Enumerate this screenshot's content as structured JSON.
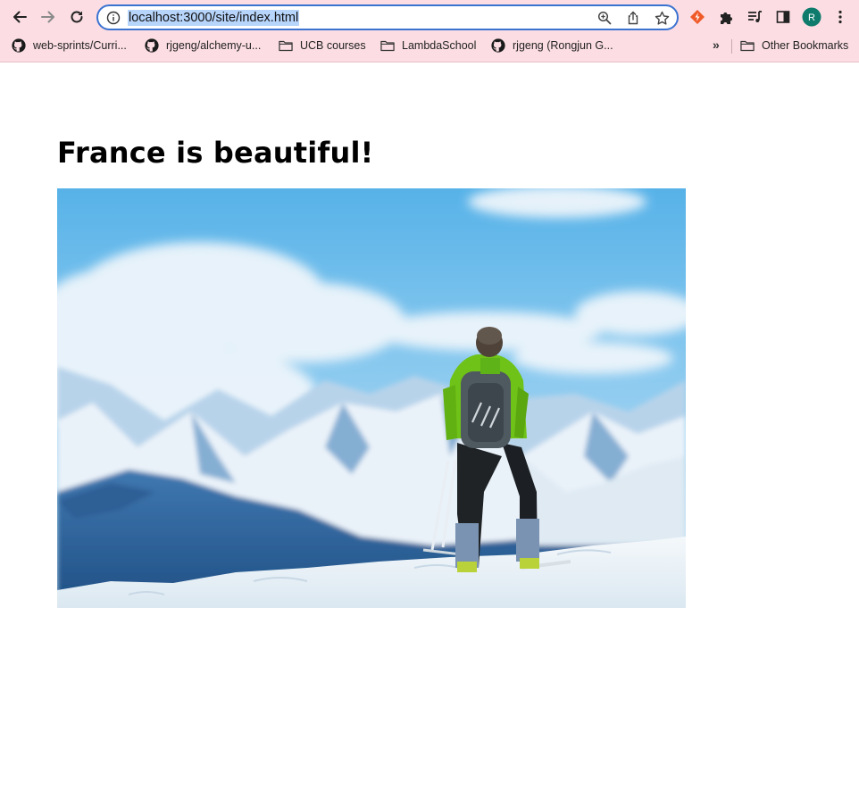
{
  "browser": {
    "url": "localhost:3000/site/index.html",
    "profile_initial": "R",
    "colors": {
      "chrome_bg": "#fbdde3",
      "omnibox_border": "#3b73d1",
      "url_selection": "#b7d4fb",
      "profile": "#0f7b6c"
    },
    "bookmarks": [
      {
        "label": "web-sprints/Curri...",
        "icon": "github-icon"
      },
      {
        "label": "rjgeng/alchemy-u...",
        "icon": "github-icon"
      },
      {
        "label": "UCB courses",
        "icon": "folder-icon"
      },
      {
        "label": "LambdaSchool",
        "icon": "folder-icon"
      },
      {
        "label": "rjgeng (Rongjun G...",
        "icon": "github-icon"
      }
    ],
    "overflow_label": "»",
    "other_bookmarks": "Other Bookmarks"
  },
  "page": {
    "heading": "France is beautiful!",
    "image": {
      "subject": "skier-in-mountains-photo"
    }
  }
}
